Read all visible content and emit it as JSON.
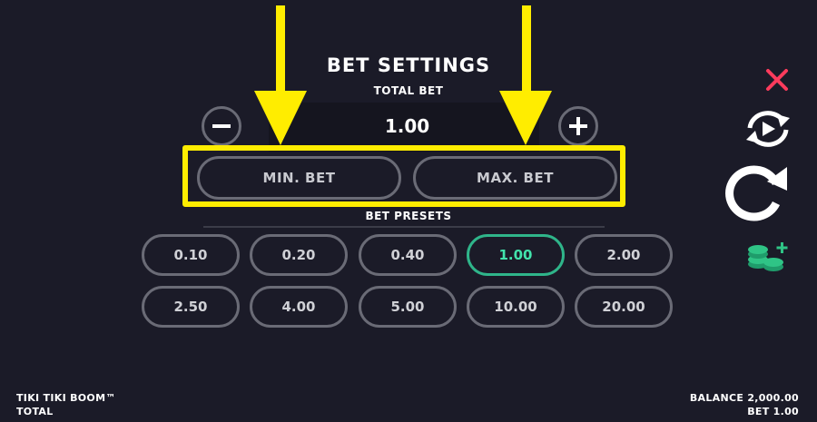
{
  "panel": {
    "title": "BET SETTINGS",
    "total_bet_label": "TOTAL BET",
    "total_bet_value": "1.00",
    "min_bet_label": "MIN. BET",
    "max_bet_label": "MAX. BET",
    "presets_label": "BET PRESETS",
    "presets": [
      "0.10",
      "0.20",
      "0.40",
      "1.00",
      "2.00",
      "2.50",
      "4.00",
      "5.00",
      "10.00",
      "20.00"
    ],
    "selected_preset": "1.00"
  },
  "side_icons": [
    "close-icon",
    "autoplay-icon",
    "spin-icon",
    "buy-coins-icon"
  ],
  "footer": {
    "game_title": "TIKI TIKI BOOM™",
    "total_label": "TOTAL",
    "balance_text": "BALANCE 2,000.00",
    "bet_text": "BET 1.00"
  },
  "colors": {
    "background": "#1b1b28",
    "highlight": "#ffed00",
    "selected": "#42e3ac",
    "close": "#ff3b5c",
    "coins": "#2fc486"
  }
}
